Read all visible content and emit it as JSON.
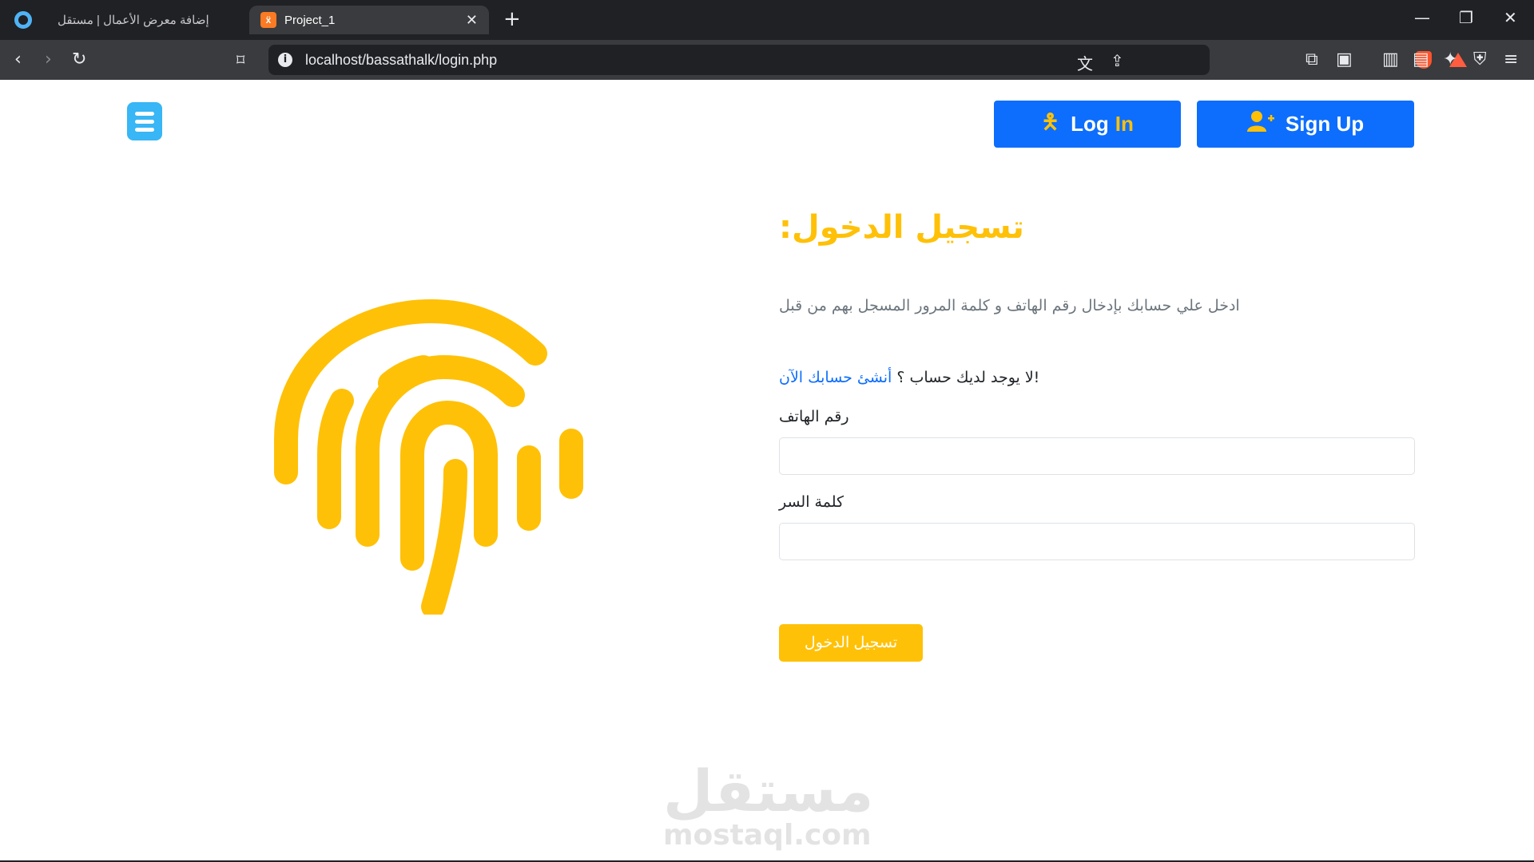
{
  "browser": {
    "tabs": [
      {
        "label": "إضافة معرض الأعمال | مستقل",
        "active": false
      },
      {
        "label": "Project_1",
        "active": true
      }
    ],
    "url": "localhost/bassathalk/login.php",
    "icons": [
      "back-icon",
      "forward-icon",
      "reload-icon",
      "bookmark-icon",
      "translate-icon",
      "share-icon",
      "brave-shields-icon",
      "brave-rewards-icon",
      "extensions-icon",
      "screenshot-icon",
      "sidebar-icon",
      "wallet-icon",
      "leo-icon",
      "vpn-icon",
      "menu-icon"
    ]
  },
  "nav": {
    "login_word1": "Log",
    "login_word2": "In",
    "signup_label": "Sign Up"
  },
  "form": {
    "title": "تسجيل الدخول:",
    "description": "ادخل علي حسابك بإدخال رقم الهاتف و كلمة المرور المسجل بهم من قبل",
    "no_account_text": "!لا يوجد لديك حساب ؟ ",
    "create_account_link": "أنشئ حسابك الآن",
    "phone_label": "رقم الهاتف",
    "phone_value": "",
    "password_label": "كلمة السر",
    "password_value": "",
    "submit_label": "تسجيل الدخول"
  },
  "watermark": {
    "arabic": "مستقل",
    "latin": "mostaql.com"
  },
  "colors": {
    "primary": "#0d6efd",
    "accent": "#ffc107",
    "logo": "#38b6f5"
  }
}
